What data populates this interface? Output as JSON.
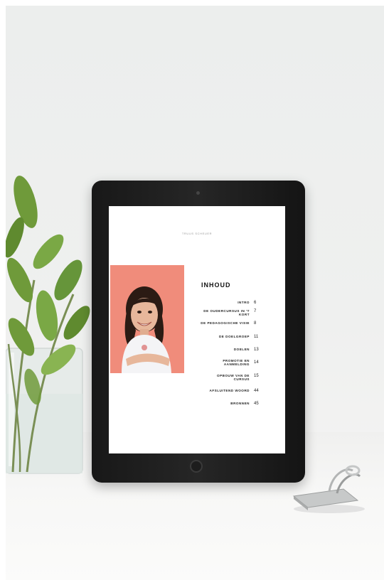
{
  "screen": {
    "header": "TRUUS SCHEUER",
    "toc_title": "INHOUD",
    "toc": [
      {
        "label": "INTRO",
        "page": "6"
      },
      {
        "label": "DE OUDERCURSUS IN 'T KORT",
        "page": "7"
      },
      {
        "label": "DE PEDAGOGISCHE VISIE",
        "page": "8"
      },
      {
        "label": "DE DOELGROEP",
        "page": "11"
      },
      {
        "label": "DOELEN",
        "page": "13"
      },
      {
        "label": "PROMOTIE EN AANMELDING",
        "page": "14"
      },
      {
        "label": "OPBOUW VAN DE CURSUS",
        "page": "15"
      },
      {
        "label": "AFSLUITEND WOORD",
        "page": "44"
      },
      {
        "label": "BRONNEN",
        "page": "45"
      }
    ]
  },
  "colors": {
    "photo_background": "#f08c7b",
    "tablet_frame": "#1f1f1f",
    "leaf_green": "#6f9a3a",
    "wall": "#eceeed"
  },
  "icons": [
    "camera-icon",
    "home-button-icon",
    "plant-image",
    "binder-clip-image"
  ]
}
